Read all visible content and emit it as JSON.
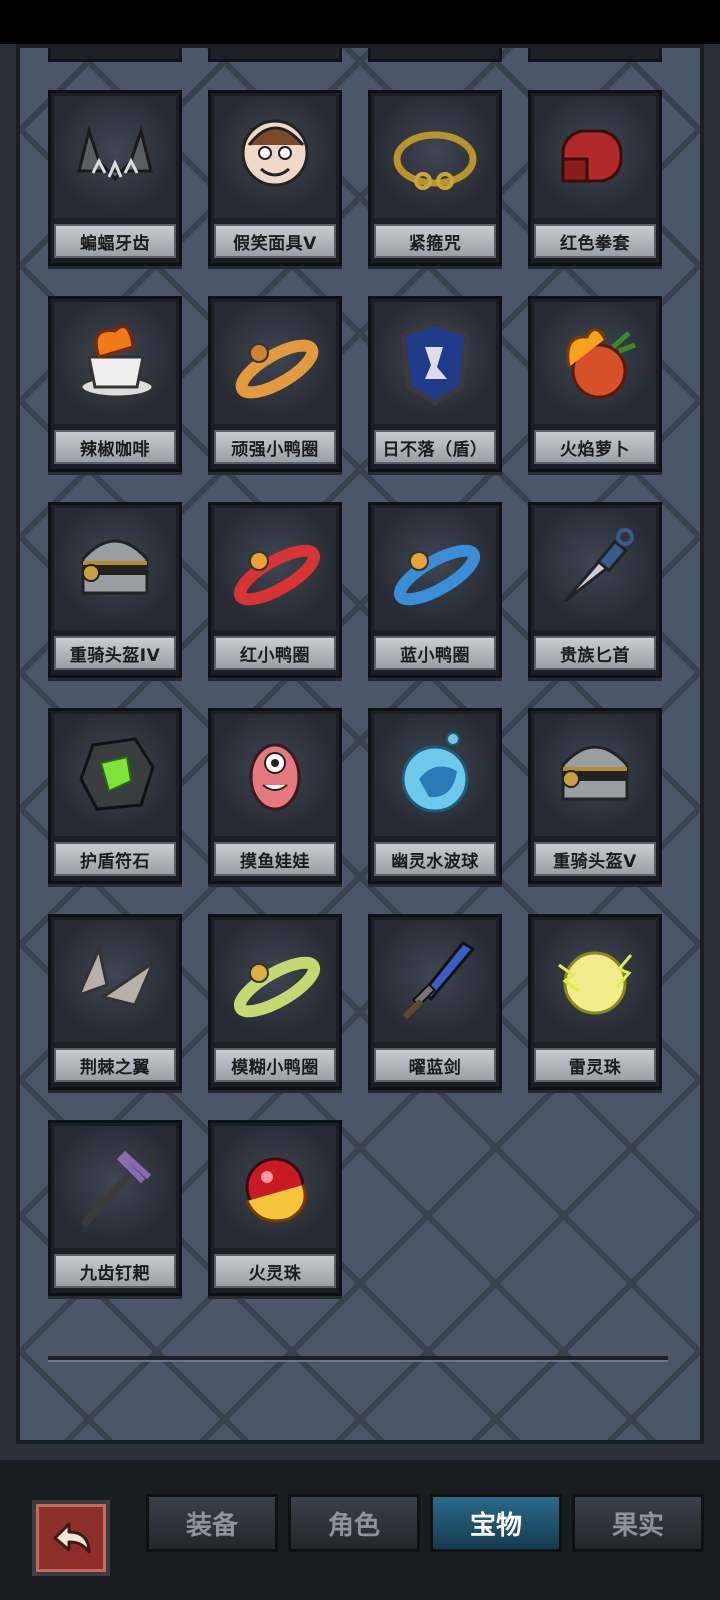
{
  "items": [
    {
      "name": "蝙蝠牙齿",
      "icon": "bat-teeth-icon"
    },
    {
      "name": "假笑面具V",
      "icon": "fake-smile-mask-icon"
    },
    {
      "name": "紧箍咒",
      "icon": "golden-headband-icon"
    },
    {
      "name": "红色拳套",
      "icon": "red-boxing-glove-icon"
    },
    {
      "name": "辣椒咖啡",
      "icon": "chili-coffee-icon"
    },
    {
      "name": "顽强小鸭圈",
      "icon": "tough-duck-ring-icon"
    },
    {
      "name": "日不落（盾）",
      "icon": "shield-icon"
    },
    {
      "name": "火焰萝卜",
      "icon": "flame-radish-icon"
    },
    {
      "name": "重骑头盔IV",
      "icon": "heavy-knight-helmet-icon"
    },
    {
      "name": "红小鸭圈",
      "icon": "red-duck-ring-icon"
    },
    {
      "name": "蓝小鸭圈",
      "icon": "blue-duck-ring-icon"
    },
    {
      "name": "贵族匕首",
      "icon": "noble-dagger-icon"
    },
    {
      "name": "护盾符石",
      "icon": "shield-rune-stone-icon"
    },
    {
      "name": "摸鱼娃娃",
      "icon": "slacker-doll-icon"
    },
    {
      "name": "幽灵水波球",
      "icon": "ghost-water-orb-icon"
    },
    {
      "name": "重骑头盔V",
      "icon": "heavy-knight-helmet-icon"
    },
    {
      "name": "荆棘之翼",
      "icon": "thorn-wings-icon"
    },
    {
      "name": "模糊小鸭圈",
      "icon": "blurry-duck-ring-icon"
    },
    {
      "name": "曜蓝剑",
      "icon": "azure-sword-icon"
    },
    {
      "name": "雷灵珠",
      "icon": "thunder-orb-icon"
    },
    {
      "name": "九齿钉耙",
      "icon": "nine-tooth-rake-icon"
    },
    {
      "name": "火灵珠",
      "icon": "fire-orb-icon"
    }
  ],
  "tabs": [
    {
      "label": "装备",
      "active": false
    },
    {
      "label": "角色",
      "active": false
    },
    {
      "label": "宝物",
      "active": true
    },
    {
      "label": "果实",
      "active": false
    }
  ],
  "colors": {
    "accent_tab": "#2a6a8a",
    "back_button": "#8c2e2a",
    "panel": "#4c566a"
  }
}
